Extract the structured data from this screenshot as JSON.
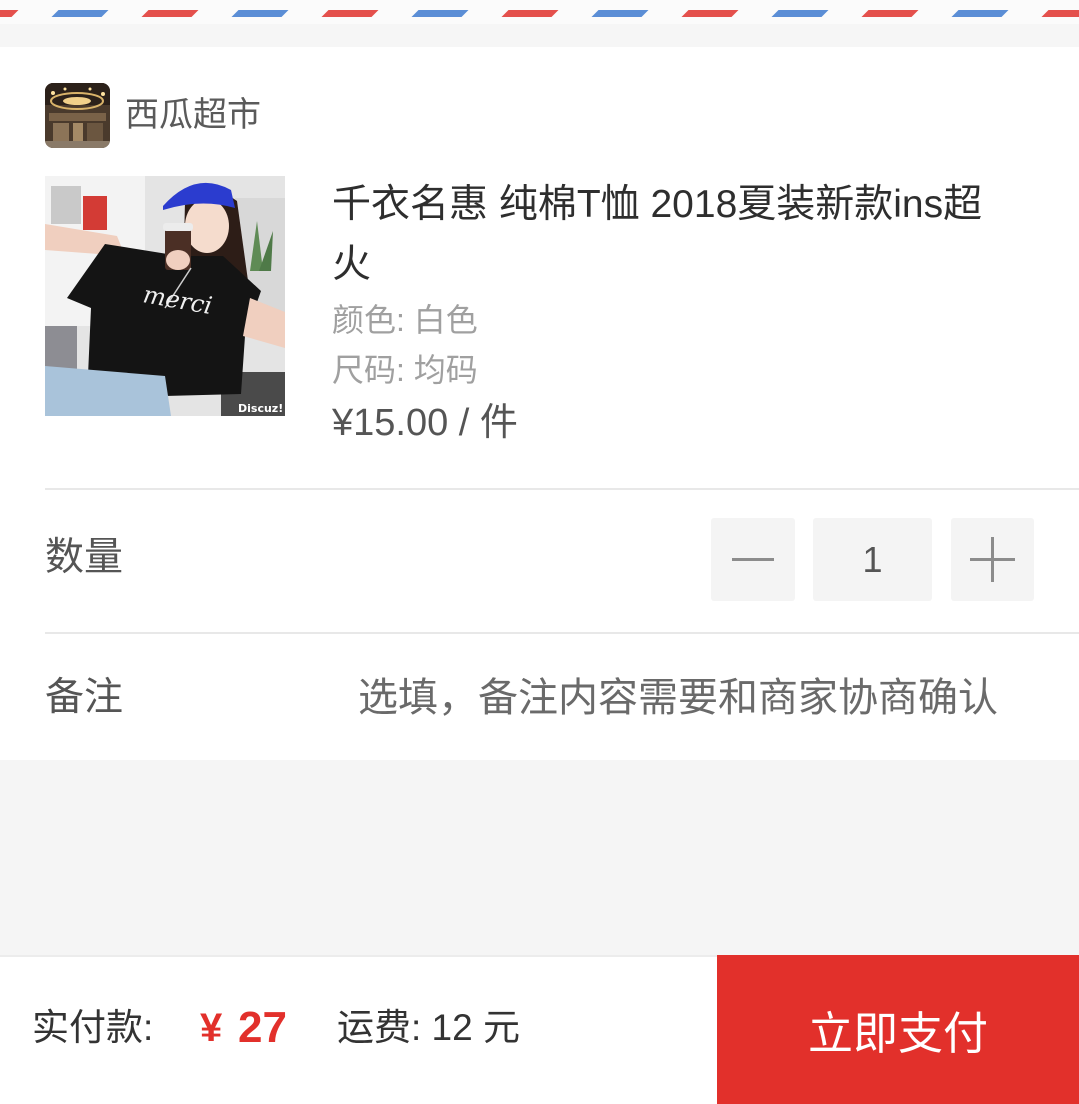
{
  "airmail_border": {
    "stripe_blue": "#5b8ed6",
    "stripe_red": "#e4504c"
  },
  "colors": {
    "accent": "#e2302b",
    "page_background": "#f5f5f5"
  },
  "shop": {
    "name": "西瓜超市",
    "avatar_icon": "shop-avatar-image"
  },
  "product": {
    "image_icon": "product-photo",
    "photo_lettering": {
      "shirt_print": "merci",
      "watermark": "Discuz!"
    },
    "title": "千衣名惠 纯棉T恤 2018夏装新款ins超火",
    "attributes": [
      "颜色: 白色",
      "尺码: 均码"
    ],
    "price": "¥15.00 / 件"
  },
  "quantity": {
    "label": "数量",
    "value": "1",
    "decrement_icon": "minus-icon",
    "increment_icon": "plus-icon"
  },
  "remark": {
    "label": "备注",
    "placeholder": "选填，备注内容需要和商家协商确认"
  },
  "footer": {
    "total_label": "实付款:",
    "total_currency": "¥",
    "total_amount": "27",
    "shipping": "运费: 12 元",
    "pay_button_label": "立即支付"
  }
}
